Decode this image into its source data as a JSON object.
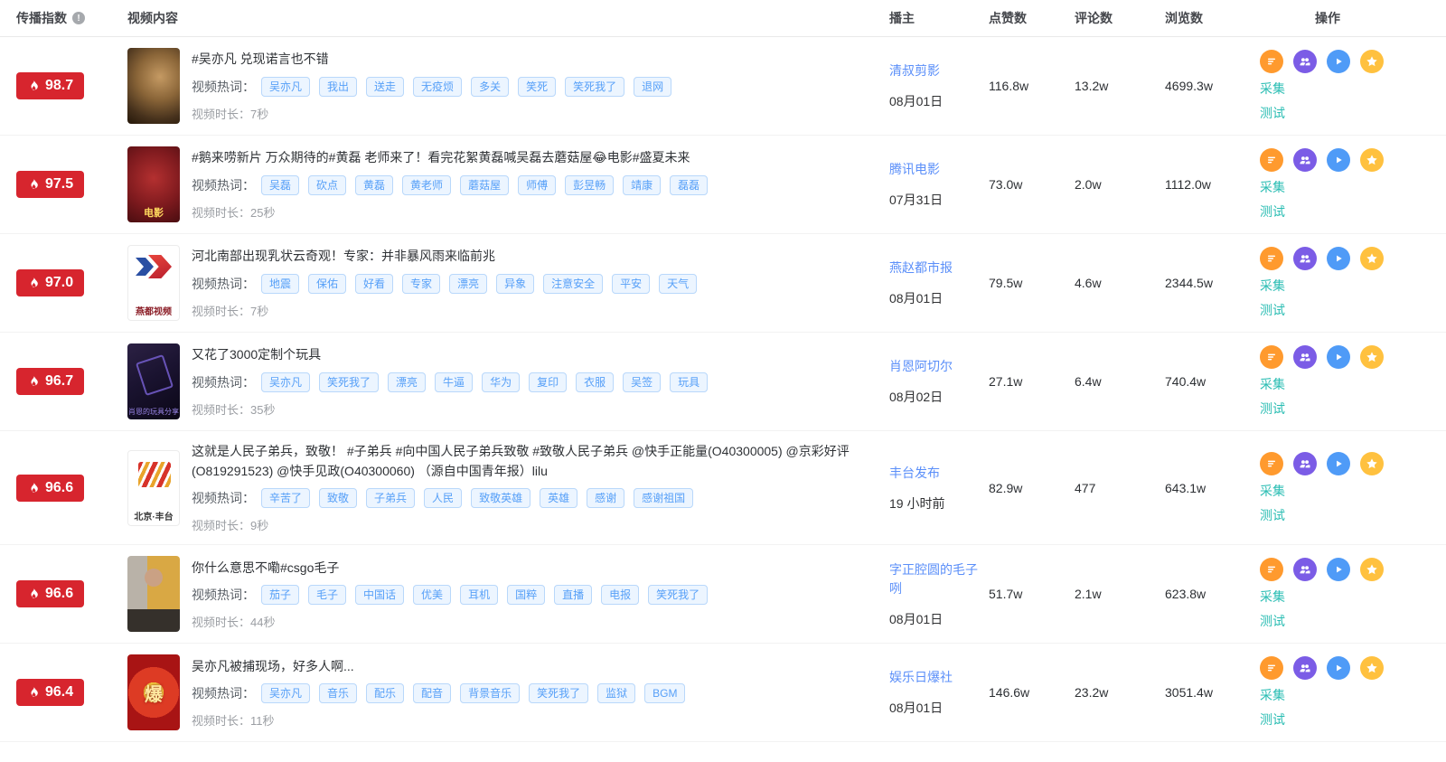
{
  "colors": {
    "index_badge_red": "#d7252e",
    "tag_bg": "#ecf5ff",
    "tag_border": "#b9d8fb",
    "tag_text": "#57a0f8",
    "author_link_blue": "#5b8ff9",
    "op_link_teal": "#2abdb3",
    "icon_detail_orange": "#ff9a2e",
    "icon_users_purple": "#7b5ce6",
    "icon_play_blue": "#4f9bf7",
    "icon_star_amber": "#ffc13f"
  },
  "table": {
    "headers": {
      "index": "传播指数",
      "content": "视频内容",
      "author": "播主",
      "likes": "点赞数",
      "comments": "评论数",
      "views": "浏览数",
      "actions": "操作"
    },
    "labels": {
      "hot_words": "视频热词：",
      "duration": "视频时长："
    },
    "ops": {
      "collect": "采集",
      "test": "测试"
    },
    "action_icons": [
      {
        "name": "detail-list-icon",
        "color": "#ff9a2e"
      },
      {
        "name": "audience-analysis-icon",
        "color": "#7b5ce6"
      },
      {
        "name": "play-video-icon",
        "color": "#4f9bf7"
      },
      {
        "name": "favorite-star-icon",
        "color": "#ffc13f"
      }
    ],
    "rows": [
      {
        "score": "98.7",
        "title": "#吴亦凡 兑现诺言也不错",
        "tags": [
          "吴亦凡",
          "我出",
          "送走",
          "无疫烦",
          "多关",
          "笑死",
          "笑死我了",
          "退网"
        ],
        "duration": "7秒",
        "author": "清叔剪影",
        "date": "08月01日",
        "likes": "116.8w",
        "comments": "13.2w",
        "views": "4699.3w",
        "thumb_caption": ""
      },
      {
        "score": "97.5",
        "title": "#鹅来唠新片 万众期待的#黄磊 老师来了！看完花絮黄磊喊吴磊去蘑菇屋😂电影#盛夏未来",
        "tags": [
          "吴磊",
          "砍点",
          "黄磊",
          "黄老师",
          "蘑菇屋",
          "师傅",
          "彭昱畅",
          "靖康",
          "磊磊"
        ],
        "duration": "25秒",
        "author": "腾讯电影",
        "date": "07月31日",
        "likes": "73.0w",
        "comments": "2.0w",
        "views": "1112.0w",
        "thumb_caption": "电影"
      },
      {
        "score": "97.0",
        "title": "河北南部出现乳状云奇观！专家：并非暴风雨来临前兆",
        "tags": [
          "地震",
          "保佑",
          "好看",
          "专家",
          "漂亮",
          "异象",
          "注意安全",
          "平安",
          "天气"
        ],
        "duration": "7秒",
        "author": "燕赵都市报",
        "date": "08月01日",
        "likes": "79.5w",
        "comments": "4.6w",
        "views": "2344.5w",
        "thumb_caption": "燕都视频"
      },
      {
        "score": "96.7",
        "title": "又花了3000定制个玩具",
        "tags": [
          "吴亦凡",
          "笑死我了",
          "漂亮",
          "牛逼",
          "华为",
          "复印",
          "衣服",
          "吴签",
          "玩具"
        ],
        "duration": "35秒",
        "author": "肖恩阿切尔",
        "date": "08月02日",
        "likes": "27.1w",
        "comments": "6.4w",
        "views": "740.4w",
        "thumb_caption": "肖恩的玩具分享"
      },
      {
        "score": "96.6",
        "title": "这就是人民子弟兵，致敬！ #子弟兵 #向中国人民子弟兵致敬 #致敬人民子弟兵 @快手正能量(O40300005) @京彩好评(O819291523) @快手见政(O40300060) （源自中国青年报）lilu",
        "tags": [
          "辛苦了",
          "致敬",
          "子弟兵",
          "人民",
          "致敬英雄",
          "英雄",
          "感谢",
          "感谢祖国"
        ],
        "duration": "9秒",
        "author": "丰台发布",
        "date": "19 小时前",
        "likes": "82.9w",
        "comments": "477",
        "views": "643.1w",
        "thumb_caption": "北京·丰台"
      },
      {
        "score": "96.6",
        "title": "你什么意思不嘞#csgo毛子",
        "tags": [
          "茄子",
          "毛子",
          "中国话",
          "优美",
          "耳机",
          "国粹",
          "直播",
          "电报",
          "笑死我了"
        ],
        "duration": "44秒",
        "author": "字正腔圆的毛子咧",
        "date": "08月01日",
        "likes": "51.7w",
        "comments": "2.1w",
        "views": "623.8w",
        "thumb_caption": ""
      },
      {
        "score": "96.4",
        "title": "吴亦凡被捕现场，好多人啊...",
        "tags": [
          "吴亦凡",
          "音乐",
          "配乐",
          "配音",
          "背景音乐",
          "笑死我了",
          "监狱",
          "BGM"
        ],
        "duration": "11秒",
        "author": "娱乐日爆社",
        "date": "08月01日",
        "likes": "146.6w",
        "comments": "23.2w",
        "views": "3051.4w",
        "thumb_caption": "爆"
      }
    ]
  }
}
